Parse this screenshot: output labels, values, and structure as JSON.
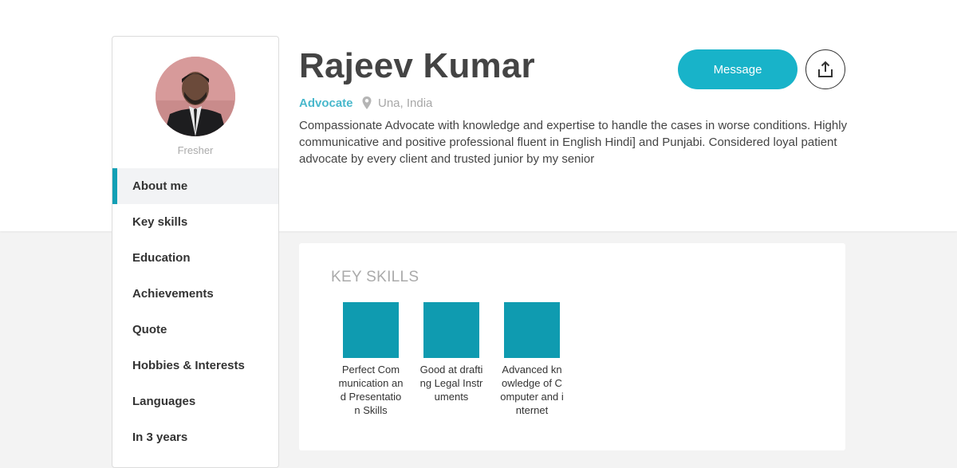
{
  "profile": {
    "name": "Rajeev Kumar",
    "role": "Advocate",
    "location": "Una, India",
    "bio": "Compassionate Advocate with knowledge and expertise to handle the cases in worse conditions. Highly communicative and positive professional fluent in English Hindi] and Punjabi. Considered loyal patient advocate by every client and trusted junior by my senior",
    "status_caption": "Fresher",
    "avatar_icon": "profile-photo"
  },
  "actions": {
    "message_label": "Message",
    "share_icon": "share-icon"
  },
  "sidebar": {
    "items": [
      {
        "label": "About me",
        "active": true
      },
      {
        "label": "Key skills"
      },
      {
        "label": "Education"
      },
      {
        "label": "Achievements"
      },
      {
        "label": "Quote"
      },
      {
        "label": "Hobbies & Interests"
      },
      {
        "label": "Languages"
      },
      {
        "label": "In 3 years"
      }
    ]
  },
  "key_skills": {
    "title": "KEY SKILLS",
    "items": [
      {
        "label": "Perfect Communication and Presentation Skills"
      },
      {
        "label": "Good at drafting Legal Instruments"
      },
      {
        "label": "Advanced knowledge of Computer and internet"
      }
    ]
  },
  "colors": {
    "accent": "#18b3c9",
    "skill_tile": "#0f9bb0",
    "role_text": "#49b8cc"
  }
}
